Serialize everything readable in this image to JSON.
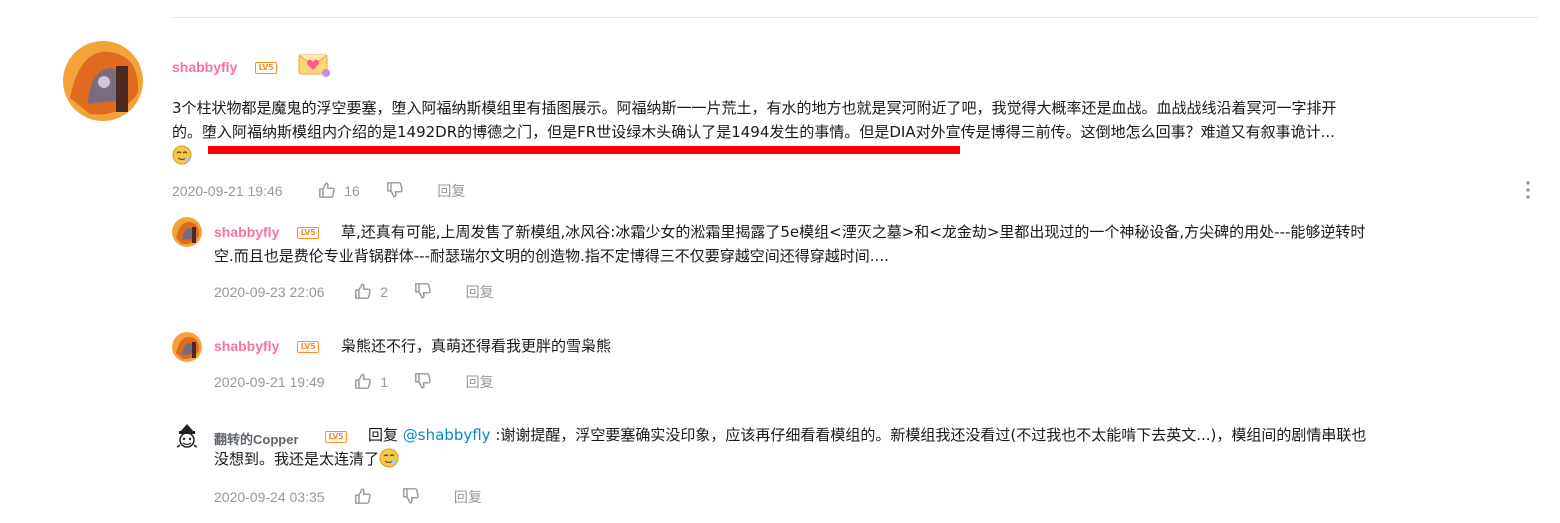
{
  "main_comment": {
    "username": "shabbyfly",
    "level": "LV5",
    "text_line1": "3个柱状物都是魔鬼的浮空要塞，堕入阿福纳斯模组里有插图展示。阿福纳斯一一片荒土，有水的地方也就是冥河附近了吧，我觉得大概率还是血战。血战战线沿着冥河一字排开",
    "text_line2": "的。堕入阿福纳斯模组内介绍的是1492DR的博德之门，但是FR世设绿木头确认了是1494发生的事情。但是DIA对外宣传是博得三前传。这倒地怎么回事？难道又有叙事诡计...",
    "date": "2020-09-21 19:46",
    "likes": "16",
    "reply_label": "回复"
  },
  "replies": [
    {
      "username": "shabbyfly",
      "level": "LV5",
      "text_line1": "草,还真有可能,上周发售了新模组,冰风谷:冰霜少女的淞霜里揭露了5e模组<湮灭之墓>和<龙金劫>里都出现过的一个神秘设备,方尖碑的用处---能够逆转时",
      "text_line2": "空.而且也是费伦专业背锅群体---耐瑟瑞尔文明的创造物.指不定博得三不仅要穿越空间还得穿越时间....",
      "date": "2020-09-23 22:06",
      "likes": "2",
      "reply_label": "回复"
    },
    {
      "username": "shabbyfly",
      "level": "LV5",
      "text_line1": "枭熊还不行，真萌还得看我更胖的雪枭熊",
      "date": "2020-09-21 19:49",
      "likes": "1",
      "reply_label": "回复"
    },
    {
      "username": "翻转的Copper",
      "level": "LV5",
      "reply_prefix": "回复",
      "mention": "@shabbyfly",
      "text_line1": ":谢谢提醒，浮空要塞确实没印象，应该再仔细看看模组的。新模组我还没看过(不过我也不太能啃下去英文...)，模组间的剧情串联也",
      "text_line2": "没想到。我还是太连清了",
      "date": "2020-09-24 03:35",
      "reply_label": "回复"
    }
  ],
  "colors": {
    "username_pink": "#fb7299",
    "level_orange": "#ff8e29",
    "meta_gray": "#9499a0",
    "mention_blue": "#008ac5",
    "highlight_red": "#ff0000"
  }
}
